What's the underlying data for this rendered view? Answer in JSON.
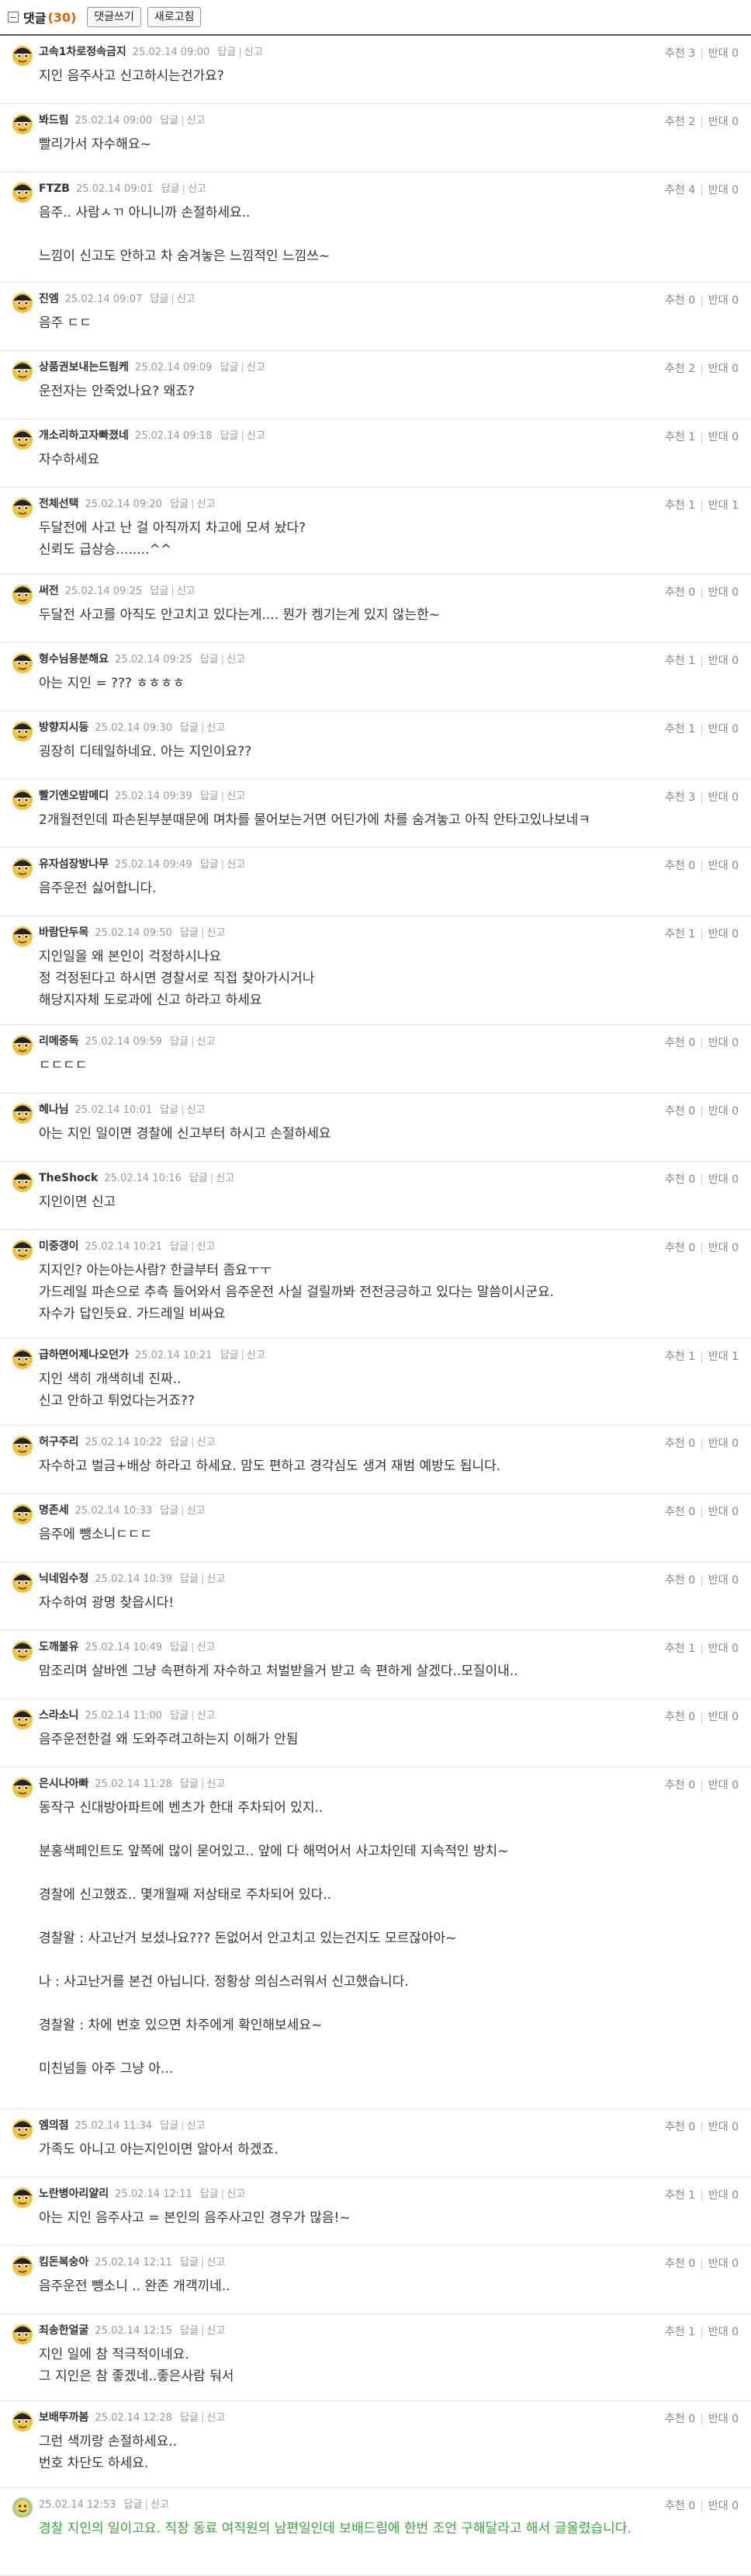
{
  "header": {
    "title": "댓글",
    "count": "(30)",
    "write_label": "댓글쓰기",
    "refresh_label": "새로고침"
  },
  "vote_labels": {
    "up": "추천",
    "down": "반대"
  },
  "action_labels": {
    "reply": "답글",
    "report": "신고"
  },
  "comments": [
    {
      "nick": "고속1차로정속금지",
      "date": "25.02.14 09:00",
      "up": "3",
      "down": "0",
      "text": "지인 음주사고 신고하시는건가요?"
    },
    {
      "nick": "봐드림",
      "date": "25.02.14 09:00",
      "up": "2",
      "down": "0",
      "text": "빨리가서 자수해요~"
    },
    {
      "nick": "FTZB",
      "date": "25.02.14 09:01",
      "up": "4",
      "down": "0",
      "text": "음주.. 사람ㅅㄲ 아니니까 손절하세요..\n\n느낌이 신고도 안하고 차 숨겨놓은 느낌적인 느낌쓰~"
    },
    {
      "nick": "진엠",
      "date": "25.02.14 09:07",
      "up": "0",
      "down": "0",
      "text": "음주 ㄷㄷ"
    },
    {
      "nick": "상품권보내는드림케",
      "date": "25.02.14 09:09",
      "up": "2",
      "down": "0",
      "text": "운전자는 안죽었나요? 왜죠?"
    },
    {
      "nick": "개소리하고자빠졌네",
      "date": "25.02.14 09:18",
      "up": "1",
      "down": "0",
      "text": "자수하세요"
    },
    {
      "nick": "전체선택",
      "date": "25.02.14 09:20",
      "up": "1",
      "down": "1",
      "text": "두달전에 사고 난 걸 아직까지 차고에 모셔 놨다?\n신뢰도 급상승........^^"
    },
    {
      "nick": "써전",
      "date": "25.02.14 09:25",
      "up": "0",
      "down": "0",
      "text": "두달전 사고를 아직도 안고치고 있다는게.... 뭔가 켕기는게 있지 않는한~"
    },
    {
      "nick": "형수님용분해요",
      "date": "25.02.14 09:25",
      "up": "1",
      "down": "0",
      "text": "아는 지인 = ??? ㅎㅎㅎㅎ"
    },
    {
      "nick": "방향지시등",
      "date": "25.02.14 09:30",
      "up": "1",
      "down": "0",
      "text": "굉장히 디테일하네요. 아는 지인이요??"
    },
    {
      "nick": "빨기엔오밤메디",
      "date": "25.02.14 09:39",
      "up": "3",
      "down": "0",
      "text": "2개월전인데 파손된부분때문에 며차를 물어보는거면 어딘가에 차를 숨겨놓고 아직 안타고있나보네ㅋ"
    },
    {
      "nick": "유자섬장방나무",
      "date": "25.02.14 09:49",
      "up": "0",
      "down": "0",
      "text": "음주운전 싫어합니다."
    },
    {
      "nick": "바람단두목",
      "date": "25.02.14 09:50",
      "up": "1",
      "down": "0",
      "text": "지인일을 왜 본인이 걱정하시나요\n정 걱정된다고 하시면 경찰서로 직접 찾아가시거나\n해당지자체 도로과에 신고 하라고 하세요"
    },
    {
      "nick": "리메중독",
      "date": "25.02.14 09:59",
      "up": "0",
      "down": "0",
      "text": "ㄷㄷㄷㄷ"
    },
    {
      "nick": "헤나님",
      "date": "25.02.14 10:01",
      "up": "0",
      "down": "0",
      "text": "아는 지인 일이면 경찰에 신고부터 하시고 손절하세요"
    },
    {
      "nick": "TheShock",
      "date": "25.02.14 10:16",
      "up": "0",
      "down": "0",
      "text": "지인이면 신고"
    },
    {
      "nick": "미중갱이",
      "date": "25.02.14 10:21",
      "up": "0",
      "down": "0",
      "text": "지지인? 아는아는사람? 한글부터 좀요ㅜㅜ\n가드레일 파손으로 추측 들어와서 음주운전 사실 걸릴까봐 전전긍긍하고 있다는 말씀이시군요.\n자수가 답인듯요. 가드레일 비싸요"
    },
    {
      "nick": "급하면어제나오던가",
      "date": "25.02.14 10:21",
      "up": "1",
      "down": "1",
      "text": "지인 색히 개색히네 진짜..\n신고 안하고 튀었다는거죠??"
    },
    {
      "nick": "허구주리",
      "date": "25.02.14 10:22",
      "up": "0",
      "down": "0",
      "text": "자수하고 벌금+배상 하라고 하세요. 맘도 편하고 경각심도 생겨 재범 예방도 됩니다."
    },
    {
      "nick": "명존세",
      "date": "25.02.14 10:33",
      "up": "0",
      "down": "0",
      "text": "음주에 뺑소니ㄷㄷㄷ"
    },
    {
      "nick": "닉네임수정",
      "date": "25.02.14 10:39",
      "up": "0",
      "down": "0",
      "text": "자수하여 광명 찾읍시다!"
    },
    {
      "nick": "도깨불유",
      "date": "25.02.14 10:49",
      "up": "1",
      "down": "0",
      "text": "맘조리며 살바엔 그냥 속편하게 자수하고 처벌받을거 받고 속 편하게 살겠다..모질이내.."
    },
    {
      "nick": "스라소니",
      "date": "25.02.14 11:00",
      "up": "0",
      "down": "0",
      "text": "음주운전한걸 왜 도와주려고하는지 이해가 안됨"
    },
    {
      "nick": "은시나아빠",
      "date": "25.02.14 11:28",
      "up": "0",
      "down": "0",
      "text": "동작구 신대방아파트에 벤츠가 한대 주차되어 있지..\n\n분홍색페인트도 앞쪽에 많이 묻어있고.. 앞에 다 해먹어서 사고차인데 지속적인 방치~\n\n경찰에 신고했죠.. 몇개월째 저상태로 주차되어 있다..\n\n경찰왈 : 사고난거 보셨나요??? 돈없어서 안고치고 있는건지도 모르잖아아~\n\n나 : 사고난거를 본건 아닙니다. 정황상 의심스러워서 신고했습니다.\n\n경찰왈 : 차에 번호 있으면 차주에게 확인해보세요~\n\n미친넘들 아주 그냥 아..."
    },
    {
      "nick": "엠의점",
      "date": "25.02.14 11:34",
      "up": "0",
      "down": "0",
      "text": "가족도 아니고 아는지인이면 알아서 하겠죠."
    },
    {
      "nick": "노란병아리얄리",
      "date": "25.02.14 12:11",
      "up": "1",
      "down": "0",
      "text": "아는 지인 음주사고 = 본인의 음주사고인 경우가 많음!~"
    },
    {
      "nick": "킴돈복숭아",
      "date": "25.02.14 12:11",
      "up": "0",
      "down": "0",
      "text": "음주운전 뺑소니 .. 완존 개객끼네.."
    },
    {
      "nick": "죄송한얼굴",
      "date": "25.02.14 12:15",
      "up": "1",
      "down": "0",
      "text": "지인 일에 참 적극적이네요.\n그 지인은 참 좋겠네..좋은사람 둬서"
    },
    {
      "nick": "보배뚜까봄",
      "date": "25.02.14 12:28",
      "up": "0",
      "down": "0",
      "text": "그런 색끼랑 손절하세요..\n번호 차단도 하세요."
    },
    {
      "nick": "",
      "date": "25.02.14 12:53",
      "up": "0",
      "down": "0",
      "text": "경찰 지인의 일이고요. 직장 동료 여직원의 남편일인데 보배드림에 한번 조언 구해달라고 해서 글올렸습니다.",
      "author": true
    }
  ]
}
